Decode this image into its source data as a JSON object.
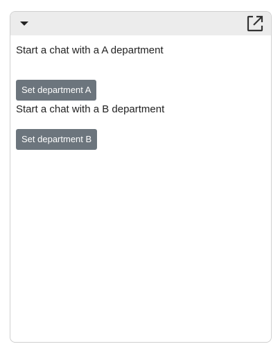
{
  "header": {
    "collapse_icon": "caret-down-icon",
    "popout_icon": "open-in-new-icon"
  },
  "content": {
    "prompt_a": "Start a chat with a A department",
    "button_a": "Set department A",
    "prompt_b": "Start a chat with a B department",
    "button_b": "Set department B"
  },
  "colors": {
    "button_bg": "#6c757d",
    "header_bg": "#ececec",
    "border": "#cfcfcf"
  }
}
